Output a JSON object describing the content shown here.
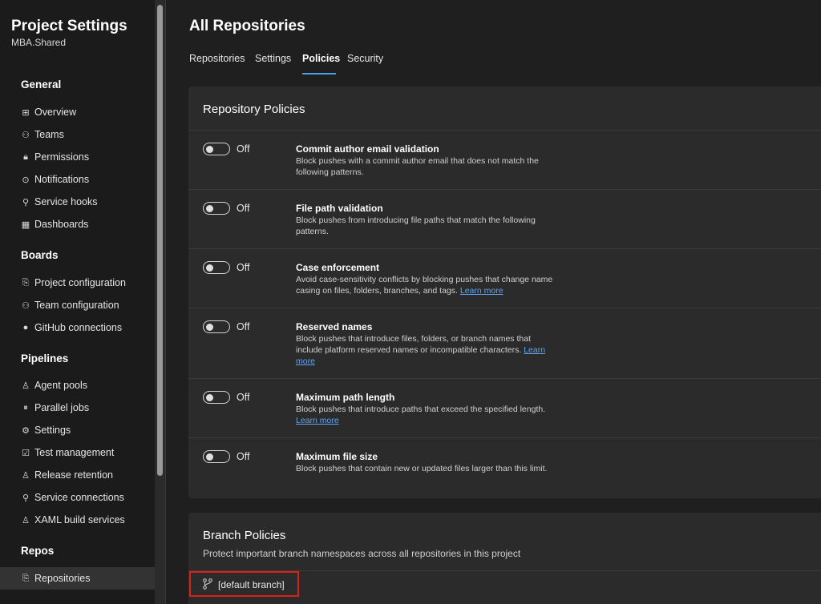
{
  "sidebar": {
    "title": "Project Settings",
    "subtitle": "MBA.Shared",
    "sections": [
      {
        "heading": "General",
        "items": [
          {
            "label": "Overview",
            "icon": "overview-icon",
            "glyph": "⊞"
          },
          {
            "label": "Teams",
            "icon": "teams-icon",
            "glyph": "⚇"
          },
          {
            "label": "Permissions",
            "icon": "lock-icon",
            "glyph": "🔒︎"
          },
          {
            "label": "Notifications",
            "icon": "notification-icon",
            "glyph": "⊙"
          },
          {
            "label": "Service hooks",
            "icon": "service-hooks-icon",
            "glyph": "⚲"
          },
          {
            "label": "Dashboards",
            "icon": "dashboard-icon",
            "glyph": "▦"
          }
        ]
      },
      {
        "heading": "Boards",
        "items": [
          {
            "label": "Project configuration",
            "icon": "project-config-icon",
            "glyph": "⎘"
          },
          {
            "label": "Team configuration",
            "icon": "team-config-icon",
            "glyph": "⚇"
          },
          {
            "label": "GitHub connections",
            "icon": "github-icon",
            "glyph": "●"
          }
        ]
      },
      {
        "heading": "Pipelines",
        "items": [
          {
            "label": "Agent pools",
            "icon": "agent-pools-icon",
            "glyph": "♙"
          },
          {
            "label": "Parallel jobs",
            "icon": "parallel-jobs-icon",
            "glyph": "⏸"
          },
          {
            "label": "Settings",
            "icon": "gear-icon",
            "glyph": "⚙"
          },
          {
            "label": "Test management",
            "icon": "test-management-icon",
            "glyph": "☑"
          },
          {
            "label": "Release retention",
            "icon": "release-retention-icon",
            "glyph": "♙"
          },
          {
            "label": "Service connections",
            "icon": "service-connections-icon",
            "glyph": "⚲"
          },
          {
            "label": "XAML build services",
            "icon": "xaml-build-icon",
            "glyph": "♙"
          }
        ]
      },
      {
        "heading": "Repos",
        "items": [
          {
            "label": "Repositories",
            "icon": "repositories-icon",
            "glyph": "⎘"
          }
        ]
      }
    ]
  },
  "main": {
    "title": "All Repositories",
    "tabs": [
      "Repositories",
      "Settings",
      "Policies",
      "Security"
    ],
    "active_tab": "Policies"
  },
  "repo_policies": {
    "title": "Repository Policies",
    "items": [
      {
        "state": "Off",
        "title": "Commit author email validation",
        "desc": "Block pushes with a commit author email that does not match the following patterns.",
        "learn_more": ""
      },
      {
        "state": "Off",
        "title": "File path validation",
        "desc": "Block pushes from introducing file paths that match the following patterns.",
        "learn_more": ""
      },
      {
        "state": "Off",
        "title": "Case enforcement",
        "desc": "Avoid case-sensitivity conflicts by blocking pushes that change name casing on files, folders, branches, and tags.",
        "learn_more": "Learn more"
      },
      {
        "state": "Off",
        "title": "Reserved names",
        "desc": "Block pushes that introduce files, folders, or branch names that include platform reserved names or incompatible characters.",
        "learn_more": "Learn more"
      },
      {
        "state": "Off",
        "title": "Maximum path length",
        "desc": "Block pushes that introduce paths that exceed the specified length.",
        "learn_more": "Learn more"
      },
      {
        "state": "Off",
        "title": "Maximum file size",
        "desc": "Block pushes that contain new or updated files larger than this limit.",
        "learn_more": ""
      }
    ]
  },
  "branch_policies": {
    "title": "Branch Policies",
    "desc": "Protect important branch namespaces across all repositories in this project",
    "branch": "[default branch]",
    "branch_icon": "branch-icon"
  },
  "colors": {
    "accent": "#4a9ef0",
    "highlight": "#d9211d",
    "background": "#1f1f1f",
    "card": "#2b2b2b"
  }
}
